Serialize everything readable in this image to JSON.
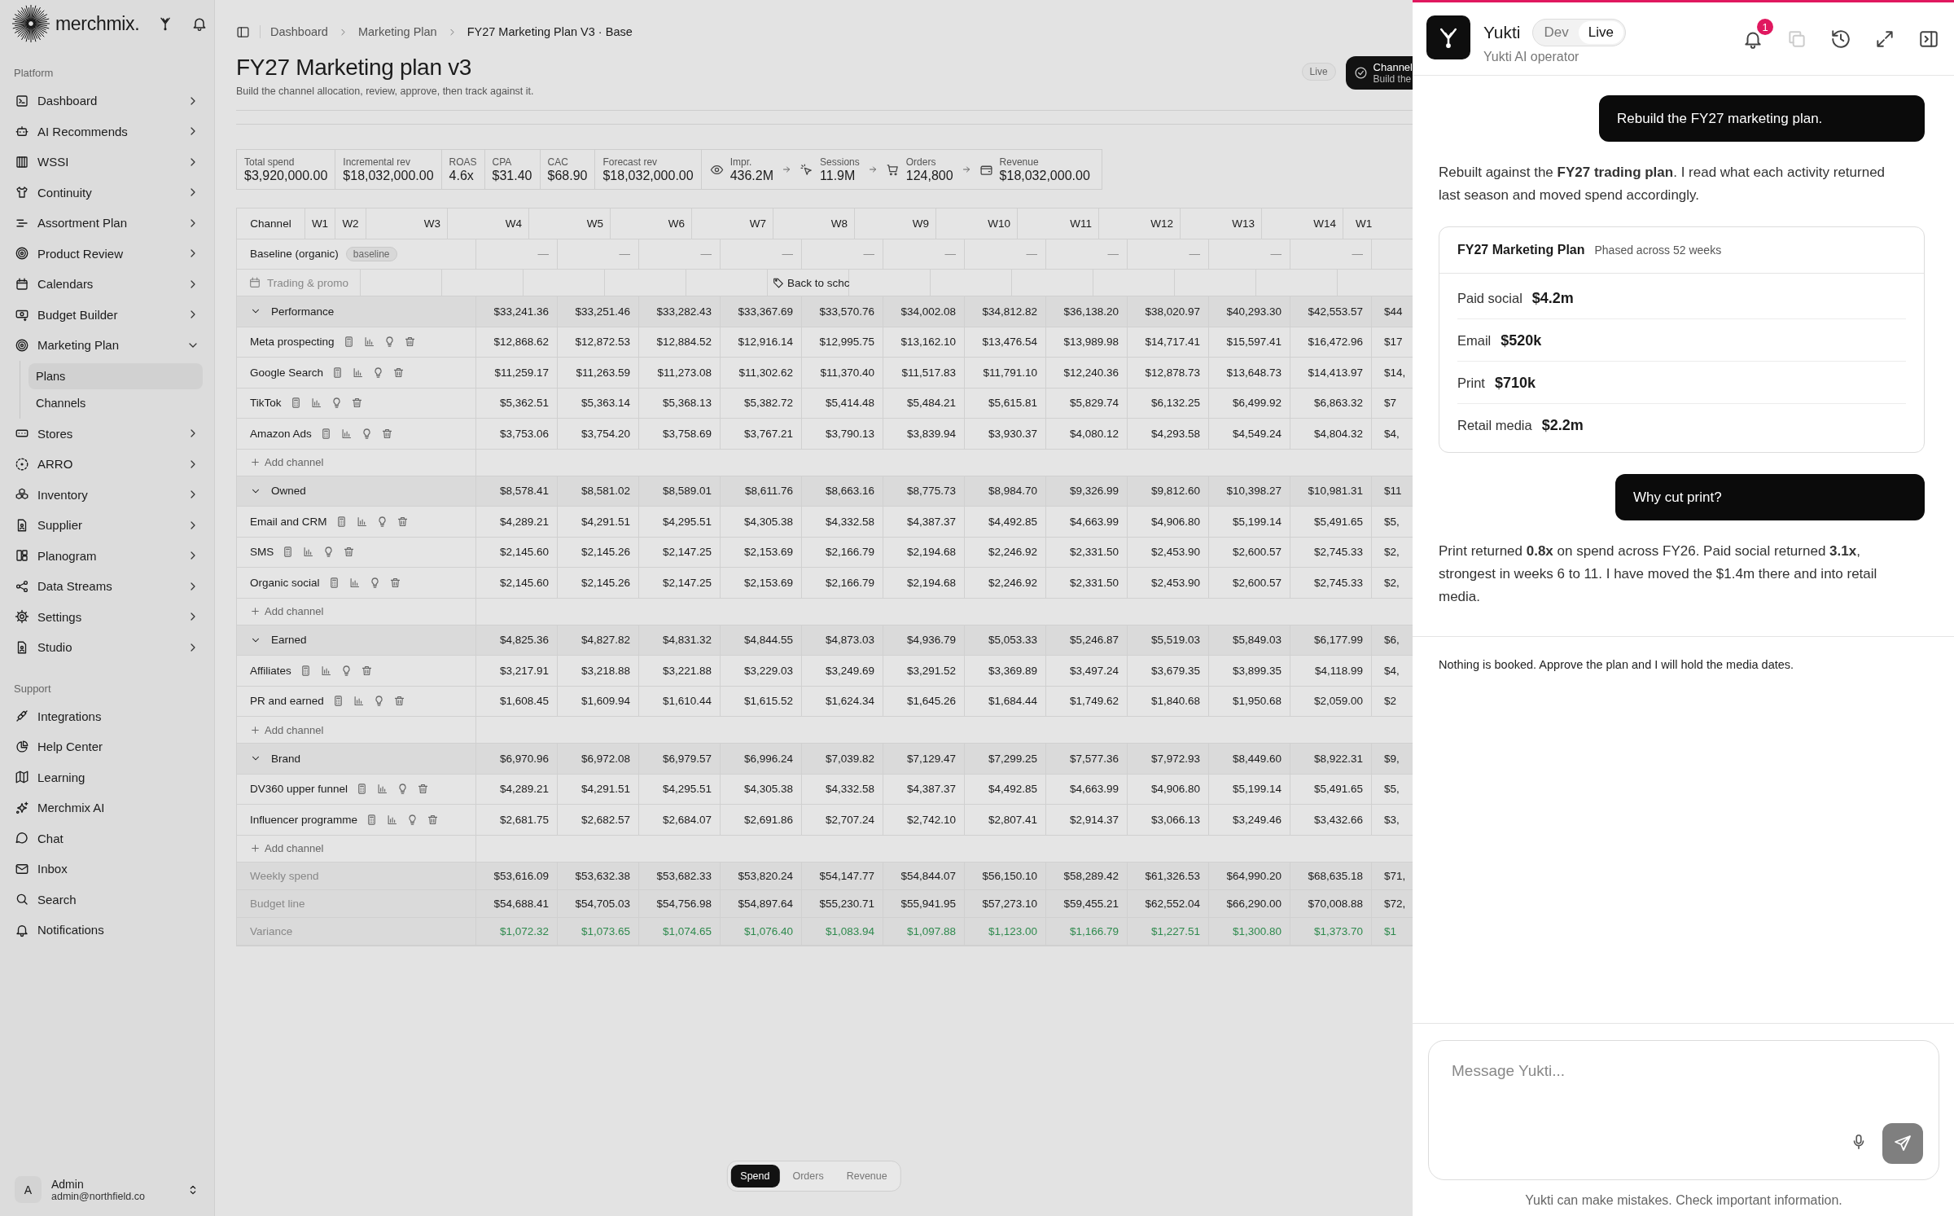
{
  "sidebar": {
    "brand": "merchmix.",
    "sections": [
      {
        "label": "Platform",
        "items": [
          {
            "label": "Dashboard",
            "expanded": false
          },
          {
            "label": "AI Recommends",
            "expanded": false
          },
          {
            "label": "WSSI",
            "expanded": false
          },
          {
            "label": "Continuity",
            "expanded": false
          },
          {
            "label": "Assortment Plan",
            "expanded": false
          },
          {
            "label": "Product Review",
            "expanded": false
          },
          {
            "label": "Calendars",
            "expanded": false
          },
          {
            "label": "Budget Builder",
            "expanded": false
          },
          {
            "label": "Marketing Plan",
            "expanded": true,
            "children": [
              {
                "label": "Plans",
                "selected": true
              },
              {
                "label": "Channels",
                "selected": false
              }
            ]
          },
          {
            "label": "Stores",
            "expanded": false
          },
          {
            "label": "ARRO",
            "expanded": false
          },
          {
            "label": "Inventory",
            "expanded": false
          },
          {
            "label": "Supplier",
            "expanded": false
          },
          {
            "label": "Planogram",
            "expanded": false
          },
          {
            "label": "Data Streams",
            "expanded": false
          },
          {
            "label": "Settings",
            "expanded": false
          },
          {
            "label": "Studio",
            "expanded": false
          }
        ]
      },
      {
        "label": "Support",
        "items": [
          {
            "label": "Integrations"
          },
          {
            "label": "Help Center"
          },
          {
            "label": "Learning"
          },
          {
            "label": "Merchmix AI"
          },
          {
            "label": "Chat"
          },
          {
            "label": "Inbox"
          },
          {
            "label": "Search"
          },
          {
            "label": "Notifications"
          }
        ]
      }
    ],
    "user": {
      "initial": "A",
      "name": "Admin",
      "email": "admin@northfield.co"
    }
  },
  "header": {
    "breadcrumbs": [
      "Dashboard",
      "Marketing Plan",
      "FY27 Marketing Plan V3 · Base"
    ],
    "title": "FY27 Marketing plan v3",
    "subtitle": "Build the channel allocation, review, approve, then track against it.",
    "status": "Live",
    "step": {
      "title": "Channel",
      "subtitle": "Build the"
    }
  },
  "kpis": [
    {
      "label": "Total spend",
      "value": "$3,920,000.00"
    },
    {
      "label": "Incremental rev",
      "value": "$18,032,000.00"
    },
    {
      "label": "ROAS",
      "value": "4.6x"
    },
    {
      "label": "CPA",
      "value": "$31.40"
    },
    {
      "label": "CAC",
      "value": "$68.90"
    },
    {
      "label": "Forecast rev",
      "value": "$18,032,000.00"
    }
  ],
  "funnel": [
    {
      "label": "Impr.",
      "value": "436.2M"
    },
    {
      "label": "Sessions",
      "value": "11.9M"
    },
    {
      "label": "Orders",
      "value": "124,800"
    },
    {
      "label": "Revenue",
      "value": "$18,032,000.00"
    }
  ],
  "table": {
    "columns": [
      "Channel",
      "W1",
      "W2",
      "W3",
      "W4",
      "W5",
      "W6",
      "W7",
      "W8",
      "W9",
      "W10",
      "W11",
      "W12",
      "W13",
      "W14",
      "W1"
    ],
    "baseline": {
      "label": "Baseline (organic)",
      "tag": "baseline",
      "cells": [
        "—",
        "—",
        "—",
        "—",
        "—",
        "—",
        "—",
        "—",
        "—",
        "—",
        "—"
      ]
    },
    "trading": {
      "label": "Trading & promo",
      "cells": [
        {
          "kind": "empty"
        },
        {
          "kind": "empty"
        },
        {
          "kind": "empty"
        },
        {
          "kind": "empty"
        },
        {
          "kind": "empty"
        },
        {
          "kind": "promo",
          "label": "Back to schc"
        },
        {
          "kind": "empty"
        },
        {
          "kind": "empty"
        },
        {
          "kind": "empty"
        },
        {
          "kind": "empty"
        },
        {
          "kind": "empty"
        },
        {
          "kind": "empty"
        }
      ]
    },
    "groups": [
      {
        "name": "Performance",
        "expanded": true,
        "totals": [
          "$33,241.36",
          "$33,251.46",
          "$33,282.43",
          "$33,367.69",
          "$33,570.76",
          "$34,002.08",
          "$34,812.82",
          "$36,138.20",
          "$38,020.97",
          "$40,293.30",
          "$42,553.57",
          "$44"
        ],
        "add_label": "Add channel",
        "channels": [
          {
            "name": "Meta prospecting",
            "values": [
              "$12,868.62",
              "$12,872.53",
              "$12,884.52",
              "$12,916.14",
              "$12,995.75",
              "$13,162.10",
              "$13,476.54",
              "$13,989.98",
              "$14,717.41",
              "$15,597.41",
              "$16,472.96",
              "$17"
            ]
          },
          {
            "name": "Google Search",
            "values": [
              "$11,259.17",
              "$11,263.59",
              "$11,273.08",
              "$11,302.62",
              "$11,370.40",
              "$11,517.83",
              "$11,791.10",
              "$12,240.36",
              "$12,878.73",
              "$13,648.73",
              "$14,413.97",
              "$14,"
            ]
          },
          {
            "name": "TikTok",
            "values": [
              "$5,362.51",
              "$5,363.14",
              "$5,368.13",
              "$5,382.72",
              "$5,414.48",
              "$5,484.21",
              "$5,615.81",
              "$5,829.74",
              "$6,132.25",
              "$6,499.92",
              "$6,863.32",
              "$7"
            ]
          },
          {
            "name": "Amazon Ads",
            "values": [
              "$3,753.06",
              "$3,754.20",
              "$3,758.69",
              "$3,767.21",
              "$3,790.13",
              "$3,839.94",
              "$3,930.37",
              "$4,080.12",
              "$4,293.58",
              "$4,549.24",
              "$4,804.32",
              "$4,"
            ]
          }
        ]
      },
      {
        "name": "Owned",
        "expanded": true,
        "totals": [
          "$8,578.41",
          "$8,581.02",
          "$8,589.01",
          "$8,611.76",
          "$8,663.16",
          "$8,775.73",
          "$8,984.70",
          "$9,326.99",
          "$9,812.60",
          "$10,398.27",
          "$10,981.31",
          "$11"
        ],
        "add_label": "Add channel",
        "channels": [
          {
            "name": "Email and CRM",
            "values": [
              "$4,289.21",
              "$4,291.51",
              "$4,295.51",
              "$4,305.38",
              "$4,332.58",
              "$4,387.37",
              "$4,492.85",
              "$4,663.99",
              "$4,906.80",
              "$5,199.14",
              "$5,491.65",
              "$5,"
            ]
          },
          {
            "name": "SMS",
            "values": [
              "$2,145.60",
              "$2,145.26",
              "$2,147.25",
              "$2,153.69",
              "$2,166.79",
              "$2,194.68",
              "$2,246.92",
              "$2,331.50",
              "$2,453.90",
              "$2,600.57",
              "$2,745.33",
              "$2,"
            ]
          },
          {
            "name": "Organic social",
            "values": [
              "$2,145.60",
              "$2,145.26",
              "$2,147.25",
              "$2,153.69",
              "$2,166.79",
              "$2,194.68",
              "$2,246.92",
              "$2,331.50",
              "$2,453.90",
              "$2,600.57",
              "$2,745.33",
              "$2,"
            ]
          }
        ]
      },
      {
        "name": "Earned",
        "expanded": true,
        "totals": [
          "$4,825.36",
          "$4,827.82",
          "$4,831.32",
          "$4,844.55",
          "$4,873.03",
          "$4,936.79",
          "$5,053.33",
          "$5,246.87",
          "$5,519.03",
          "$5,849.03",
          "$6,177.99",
          "$6,"
        ],
        "add_label": "Add channel",
        "channels": [
          {
            "name": "Affiliates",
            "values": [
              "$3,217.91",
              "$3,218.88",
              "$3,221.88",
              "$3,229.03",
              "$3,249.69",
              "$3,291.52",
              "$3,369.89",
              "$3,497.24",
              "$3,679.35",
              "$3,899.35",
              "$4,118.99",
              "$4,"
            ]
          },
          {
            "name": "PR and earned",
            "values": [
              "$1,608.45",
              "$1,609.94",
              "$1,610.44",
              "$1,615.52",
              "$1,624.34",
              "$1,645.26",
              "$1,684.44",
              "$1,749.62",
              "$1,840.68",
              "$1,950.68",
              "$2,059.00",
              "$2"
            ]
          }
        ]
      },
      {
        "name": "Brand",
        "expanded": true,
        "totals": [
          "$6,970.96",
          "$6,972.08",
          "$6,979.57",
          "$6,996.24",
          "$7,039.82",
          "$7,129.47",
          "$7,299.25",
          "$7,577.36",
          "$7,972.93",
          "$8,449.60",
          "$8,922.31",
          "$9,"
        ],
        "add_label": "Add channel",
        "channels": [
          {
            "name": "DV360 upper funnel",
            "values": [
              "$4,289.21",
              "$4,291.51",
              "$4,295.51",
              "$4,305.38",
              "$4,332.58",
              "$4,387.37",
              "$4,492.85",
              "$4,663.99",
              "$4,906.80",
              "$5,199.14",
              "$5,491.65",
              "$5,"
            ]
          },
          {
            "name": "Influencer programme",
            "values": [
              "$2,681.75",
              "$2,682.57",
              "$2,684.07",
              "$2,691.86",
              "$2,707.24",
              "$2,742.10",
              "$2,807.41",
              "$2,914.37",
              "$3,066.13",
              "$3,249.46",
              "$3,432.66",
              "$3,"
            ]
          }
        ]
      }
    ],
    "footer": [
      {
        "label": "Weekly spend",
        "kind": "total",
        "values": [
          "$53,616.09",
          "$53,632.38",
          "$53,682.33",
          "$53,820.24",
          "$54,147.77",
          "$54,844.07",
          "$56,150.10",
          "$58,289.42",
          "$61,326.53",
          "$64,990.20",
          "$68,635.18",
          "$71,"
        ]
      },
      {
        "label": "Budget line",
        "kind": "total",
        "values": [
          "$54,688.41",
          "$54,705.03",
          "$54,756.98",
          "$54,897.64",
          "$55,230.71",
          "$55,941.95",
          "$57,273.10",
          "$59,455.21",
          "$62,552.04",
          "$66,290.00",
          "$70,008.88",
          "$72,"
        ]
      },
      {
        "label": "Variance",
        "kind": "variance",
        "values": [
          "$1,072.32",
          "$1,073.65",
          "$1,074.65",
          "$1,076.40",
          "$1,083.94",
          "$1,097.88",
          "$1,123.00",
          "$1,166.79",
          "$1,227.51",
          "$1,300.80",
          "$1,373.70",
          "$1"
        ]
      }
    ]
  },
  "view_toggle": [
    {
      "label": "Spend",
      "selected": true
    },
    {
      "label": "Orders",
      "selected": false
    },
    {
      "label": "Revenue",
      "selected": false
    }
  ],
  "assistant": {
    "name": "Yukti",
    "subtitle": "Yukti AI operator",
    "modes": [
      {
        "label": "Dev",
        "selected": false
      },
      {
        "label": "Live",
        "selected": true
      }
    ],
    "notifications": "1",
    "messages": [
      {
        "kind": "user",
        "text": "Rebuild the FY27 marketing plan."
      },
      {
        "kind": "assistant",
        "text": "Rebuilt against the **FY27 trading plan**. I read what each activity returned last season and moved spend accordingly."
      },
      {
        "kind": "card",
        "title": "FY27 Marketing Plan",
        "subtitle": "Phased across 52 weeks",
        "rows": [
          {
            "label": "Paid social",
            "value": "$4.2m"
          },
          {
            "label": "Email",
            "value": "$520k"
          },
          {
            "label": "Print",
            "value": "$710k"
          },
          {
            "label": "Retail media",
            "value": "$2.2m"
          }
        ]
      },
      {
        "kind": "user",
        "text": "Why cut print?"
      },
      {
        "kind": "assistant",
        "text": "Print returned **0.8x** on spend across FY26. Paid social returned **3.1x**, strongest in weeks 6 to 11. I have moved the $1.4m there and into retail media."
      },
      {
        "kind": "note",
        "text": "Nothing is booked. Approve the plan and I will hold the media dates."
      }
    ],
    "input": {
      "placeholder": "Message Yukti..."
    },
    "disclaimer": "Yukti can make mistakes. Check important information."
  }
}
